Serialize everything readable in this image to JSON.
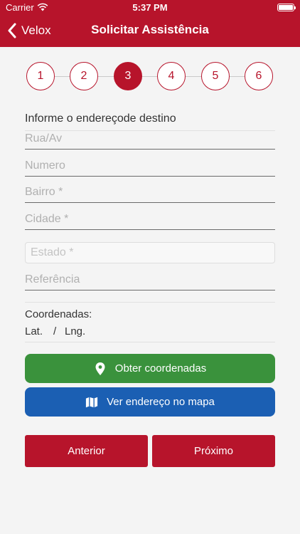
{
  "status_bar": {
    "carrier": "Carrier",
    "time": "5:37 PM"
  },
  "nav": {
    "back_label": "Velox",
    "title": "Solicitar Assistência"
  },
  "steps": [
    "1",
    "2",
    "3",
    "4",
    "5",
    "6"
  ],
  "active_step": "3",
  "form": {
    "section_title": "Informe o endereçode destino",
    "fields": {
      "rua": "Rua/Av",
      "numero": "Numero",
      "bairro": "Bairro *",
      "cidade": "Cidade *",
      "estado": "Estado *",
      "referencia": "Referência"
    },
    "coordinates_label": "Coordenadas:",
    "lat_label": "Lat.",
    "separator": "/",
    "lng_label": "Lng."
  },
  "buttons": {
    "get_coordinates": "Obter coordenadas",
    "view_map": "Ver endereço no mapa",
    "previous": "Anterior",
    "next": "Próximo"
  },
  "colors": {
    "brand_red": "#b7142b",
    "green": "#3a923c",
    "blue": "#1b5fb3"
  }
}
